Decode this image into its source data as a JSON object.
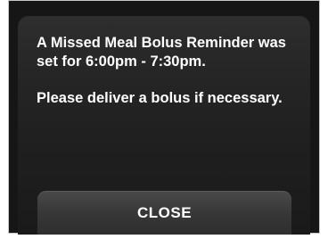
{
  "dialog": {
    "message_line1": "A Missed Meal Bolus Reminder was set for 6:00pm - 7:30pm.",
    "message_line2": "Please deliver a bolus if necessary.",
    "close_label": "CLOSE"
  },
  "colors": {
    "background": "#161616",
    "text": "#ffffff",
    "button": "#383838"
  }
}
